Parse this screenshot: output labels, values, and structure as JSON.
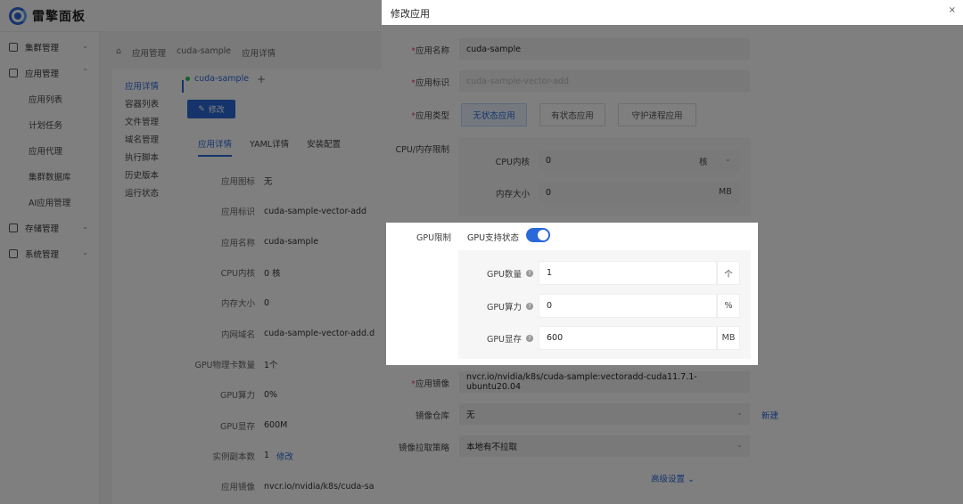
{
  "app": {
    "logo_text": "雷擎面板"
  },
  "sidebar": {
    "groups": [
      {
        "label": "集群管理"
      },
      {
        "label": "应用管理"
      },
      {
        "label": "存储管理"
      },
      {
        "label": "系统管理"
      }
    ],
    "app_items": [
      "应用列表",
      "计划任务",
      "应用代理",
      "集群数据库",
      "AI应用管理"
    ]
  },
  "breadcrumb": [
    "应用管理",
    "cuda-sample",
    "应用详情"
  ],
  "detail": {
    "tabs": [
      "应用详情",
      "容器列表",
      "文件管理",
      "域名管理",
      "执行脚本",
      "历史版本",
      "运行状态"
    ],
    "app_name": "cuda-sample",
    "plus": "+",
    "edit_label": "修改",
    "sub_tabs": [
      "应用详情",
      "YAML详情",
      "安装配置"
    ],
    "rows": [
      {
        "key": "应用图标",
        "value": "无"
      },
      {
        "key": "应用标识",
        "value": "cuda-sample-vector-add"
      },
      {
        "key": "应用名称",
        "value": "cuda-sample"
      },
      {
        "key": "CPU内核",
        "value": "0 核"
      },
      {
        "key": "内存大小",
        "value": "0"
      },
      {
        "key": "内网域名",
        "value": "cuda-sample-vector-add.d"
      },
      {
        "key": "GPU物理卡数量",
        "value": "1个"
      },
      {
        "key": "GPU算力",
        "value": "0%"
      },
      {
        "key": "GPU显存",
        "value": "600M"
      },
      {
        "key": "实例副本数",
        "value": "1",
        "link": "修改"
      },
      {
        "key": "应用镜像",
        "value": "nvcr.io/nvidia/k8s/cuda-sa"
      }
    ]
  },
  "drawer": {
    "title": "修改应用",
    "close": "×",
    "name_label": "应用名称",
    "name_value": "cuda-sample",
    "id_label": "应用标识",
    "id_value": "cuda-sample-vector-add",
    "type_label": "应用类型",
    "types": [
      "无状态应用",
      "有状态应用",
      "守护进程应用"
    ],
    "cpu_mem_label": "CPU/内存限制",
    "cpu_label": "CPU内核",
    "cpu_value": "0",
    "cpu_unit": "核",
    "mem_label": "内存大小",
    "mem_value": "0",
    "mem_unit": "MB",
    "gpu_limit_label": "GPU限制",
    "gpu_support_label": "GPU支持状态",
    "gpu_support_on": true,
    "gpu_fields": [
      {
        "label": "GPU数量",
        "value": "1",
        "unit": "个"
      },
      {
        "label": "GPU算力",
        "value": "0",
        "unit": "%"
      },
      {
        "label": "GPU显存",
        "value": "600",
        "unit": "MB"
      }
    ],
    "image_label": "应用镜像",
    "image_value": "nvcr.io/nvidia/k8s/cuda-sample:vectoradd-cuda11.7.1-ubuntu20.04",
    "repo_label": "镜像仓库",
    "repo_value": "无",
    "repo_new": "新建",
    "pull_label": "镜像拉取策略",
    "pull_value": "本地有不拉取",
    "advanced": "高级设置"
  },
  "colors": {
    "primary": "#2b68d9",
    "required": "#e34d59",
    "running": "#2ebd59"
  }
}
